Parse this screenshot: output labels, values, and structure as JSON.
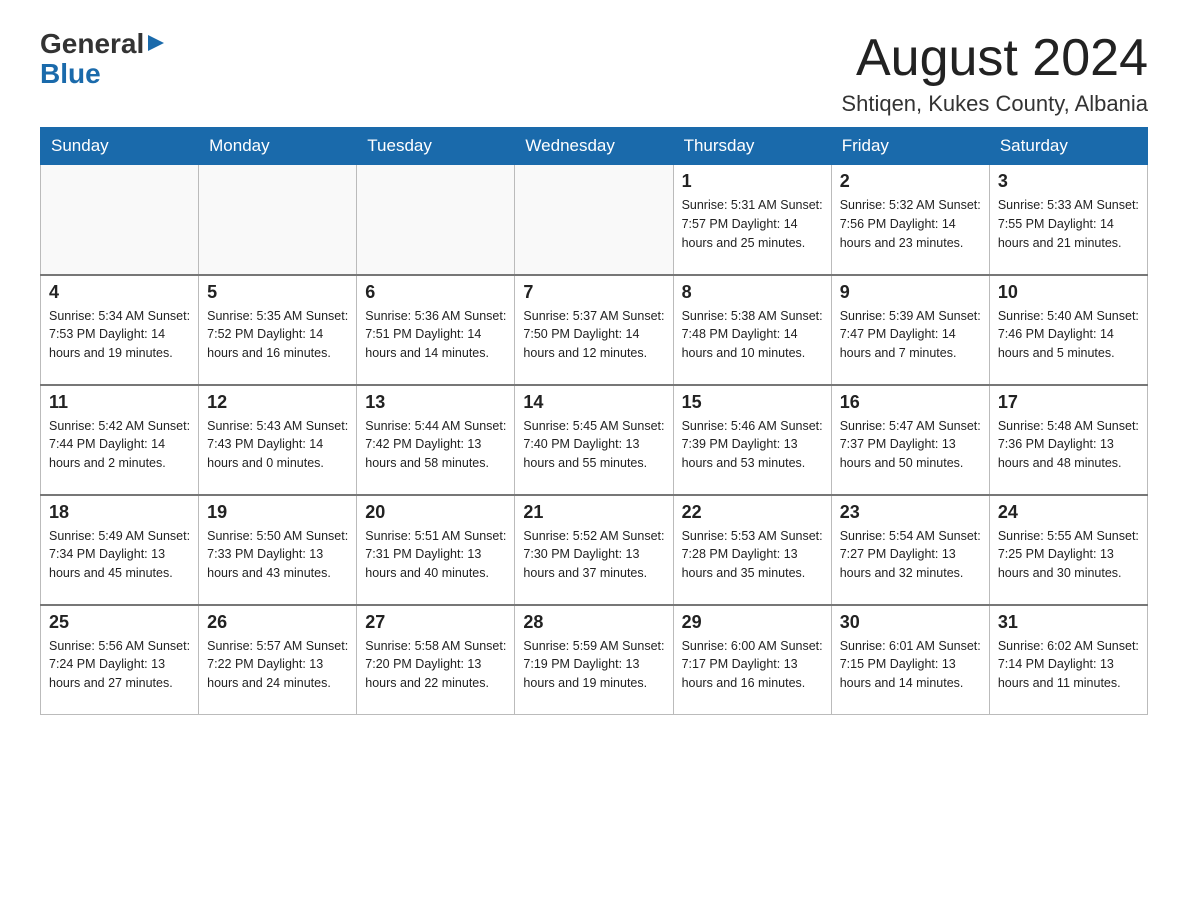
{
  "header": {
    "logo_general": "General",
    "logo_blue": "Blue",
    "month_title": "August 2024",
    "location": "Shtiqen, Kukes County, Albania"
  },
  "weekdays": [
    "Sunday",
    "Monday",
    "Tuesday",
    "Wednesday",
    "Thursday",
    "Friday",
    "Saturday"
  ],
  "weeks": [
    [
      {
        "day": "",
        "info": ""
      },
      {
        "day": "",
        "info": ""
      },
      {
        "day": "",
        "info": ""
      },
      {
        "day": "",
        "info": ""
      },
      {
        "day": "1",
        "info": "Sunrise: 5:31 AM\nSunset: 7:57 PM\nDaylight: 14 hours and 25 minutes."
      },
      {
        "day": "2",
        "info": "Sunrise: 5:32 AM\nSunset: 7:56 PM\nDaylight: 14 hours and 23 minutes."
      },
      {
        "day": "3",
        "info": "Sunrise: 5:33 AM\nSunset: 7:55 PM\nDaylight: 14 hours and 21 minutes."
      }
    ],
    [
      {
        "day": "4",
        "info": "Sunrise: 5:34 AM\nSunset: 7:53 PM\nDaylight: 14 hours and 19 minutes."
      },
      {
        "day": "5",
        "info": "Sunrise: 5:35 AM\nSunset: 7:52 PM\nDaylight: 14 hours and 16 minutes."
      },
      {
        "day": "6",
        "info": "Sunrise: 5:36 AM\nSunset: 7:51 PM\nDaylight: 14 hours and 14 minutes."
      },
      {
        "day": "7",
        "info": "Sunrise: 5:37 AM\nSunset: 7:50 PM\nDaylight: 14 hours and 12 minutes."
      },
      {
        "day": "8",
        "info": "Sunrise: 5:38 AM\nSunset: 7:48 PM\nDaylight: 14 hours and 10 minutes."
      },
      {
        "day": "9",
        "info": "Sunrise: 5:39 AM\nSunset: 7:47 PM\nDaylight: 14 hours and 7 minutes."
      },
      {
        "day": "10",
        "info": "Sunrise: 5:40 AM\nSunset: 7:46 PM\nDaylight: 14 hours and 5 minutes."
      }
    ],
    [
      {
        "day": "11",
        "info": "Sunrise: 5:42 AM\nSunset: 7:44 PM\nDaylight: 14 hours and 2 minutes."
      },
      {
        "day": "12",
        "info": "Sunrise: 5:43 AM\nSunset: 7:43 PM\nDaylight: 14 hours and 0 minutes."
      },
      {
        "day": "13",
        "info": "Sunrise: 5:44 AM\nSunset: 7:42 PM\nDaylight: 13 hours and 58 minutes."
      },
      {
        "day": "14",
        "info": "Sunrise: 5:45 AM\nSunset: 7:40 PM\nDaylight: 13 hours and 55 minutes."
      },
      {
        "day": "15",
        "info": "Sunrise: 5:46 AM\nSunset: 7:39 PM\nDaylight: 13 hours and 53 minutes."
      },
      {
        "day": "16",
        "info": "Sunrise: 5:47 AM\nSunset: 7:37 PM\nDaylight: 13 hours and 50 minutes."
      },
      {
        "day": "17",
        "info": "Sunrise: 5:48 AM\nSunset: 7:36 PM\nDaylight: 13 hours and 48 minutes."
      }
    ],
    [
      {
        "day": "18",
        "info": "Sunrise: 5:49 AM\nSunset: 7:34 PM\nDaylight: 13 hours and 45 minutes."
      },
      {
        "day": "19",
        "info": "Sunrise: 5:50 AM\nSunset: 7:33 PM\nDaylight: 13 hours and 43 minutes."
      },
      {
        "day": "20",
        "info": "Sunrise: 5:51 AM\nSunset: 7:31 PM\nDaylight: 13 hours and 40 minutes."
      },
      {
        "day": "21",
        "info": "Sunrise: 5:52 AM\nSunset: 7:30 PM\nDaylight: 13 hours and 37 minutes."
      },
      {
        "day": "22",
        "info": "Sunrise: 5:53 AM\nSunset: 7:28 PM\nDaylight: 13 hours and 35 minutes."
      },
      {
        "day": "23",
        "info": "Sunrise: 5:54 AM\nSunset: 7:27 PM\nDaylight: 13 hours and 32 minutes."
      },
      {
        "day": "24",
        "info": "Sunrise: 5:55 AM\nSunset: 7:25 PM\nDaylight: 13 hours and 30 minutes."
      }
    ],
    [
      {
        "day": "25",
        "info": "Sunrise: 5:56 AM\nSunset: 7:24 PM\nDaylight: 13 hours and 27 minutes."
      },
      {
        "day": "26",
        "info": "Sunrise: 5:57 AM\nSunset: 7:22 PM\nDaylight: 13 hours and 24 minutes."
      },
      {
        "day": "27",
        "info": "Sunrise: 5:58 AM\nSunset: 7:20 PM\nDaylight: 13 hours and 22 minutes."
      },
      {
        "day": "28",
        "info": "Sunrise: 5:59 AM\nSunset: 7:19 PM\nDaylight: 13 hours and 19 minutes."
      },
      {
        "day": "29",
        "info": "Sunrise: 6:00 AM\nSunset: 7:17 PM\nDaylight: 13 hours and 16 minutes."
      },
      {
        "day": "30",
        "info": "Sunrise: 6:01 AM\nSunset: 7:15 PM\nDaylight: 13 hours and 14 minutes."
      },
      {
        "day": "31",
        "info": "Sunrise: 6:02 AM\nSunset: 7:14 PM\nDaylight: 13 hours and 11 minutes."
      }
    ]
  ]
}
